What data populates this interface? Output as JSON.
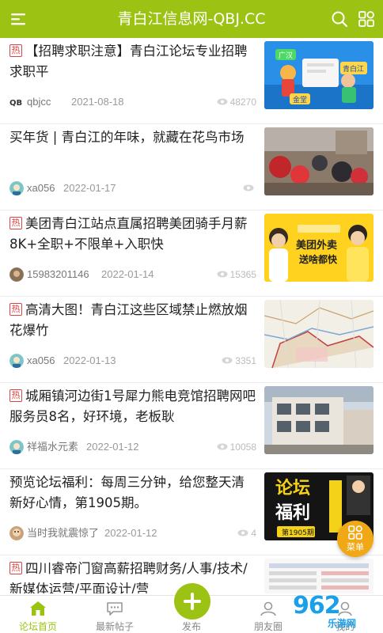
{
  "header": {
    "title": "青白江信息网-QBJ.CC",
    "menu_icon": "hamburger-icon",
    "search_icon": "search-icon",
    "grid_icon": "grid-icon",
    "bg_color": "#9cc313"
  },
  "posts": [
    {
      "hot": true,
      "tag": "热",
      "title": "【招聘求职注意】青白江论坛专业招聘求职平",
      "author": "qbjcc",
      "date": "2021-08-18",
      "views": "48270",
      "thumb_labels": [
        "广汉",
        "青白江",
        "金堂"
      ]
    },
    {
      "hot": false,
      "tag": "",
      "title": "买年货 | 青白江的年味，就藏在花鸟市场",
      "author": "xa056",
      "date": "2022-01-17",
      "views": "",
      "thumb_labels": []
    },
    {
      "hot": true,
      "tag": "热",
      "title": "美团青白江站点直属招聘美团骑手月薪8K+全职+不限单+入职快",
      "author": "15983201146",
      "date": "2022-01-14",
      "views": "15365",
      "thumb_labels": [
        "美团外卖",
        "送啥都快"
      ]
    },
    {
      "hot": true,
      "tag": "热",
      "title": "高清大图！青白江这些区域禁止燃放烟花爆竹",
      "author": "xa056",
      "date": "2022-01-13",
      "views": "3351",
      "thumb_labels": []
    },
    {
      "hot": true,
      "tag": "热",
      "title": "城厢镇河边街1号犀力熊电竞馆招聘网吧服务员8名，好环境，老板耿",
      "author": "祥福水元素",
      "date": "2022-01-12",
      "views": "10058",
      "thumb_labels": []
    },
    {
      "hot": false,
      "tag": "",
      "title": "预览论坛福利：每周三分钟，给您整天清新好心情，第1905期。",
      "author": "当时我就震惊了",
      "date": "2022-01-12",
      "views": "4",
      "thumb_labels": [
        "论坛",
        "福利",
        "第1905期"
      ]
    },
    {
      "hot": true,
      "tag": "热",
      "title": "四川睿帝门窗高薪招聘财务/人事/技术/新媒体运营/平面设计/营",
      "author": "",
      "date": "",
      "views": "",
      "thumb_labels": []
    }
  ],
  "fab": {
    "label": "菜单",
    "icon": "apps-icon"
  },
  "tabs": [
    {
      "label": "论坛首页",
      "icon": "home-icon",
      "active": true
    },
    {
      "label": "最新帖子",
      "icon": "chat-icon",
      "active": false
    },
    {
      "label": "发布",
      "icon": "plus-icon",
      "active": false
    },
    {
      "label": "朋友圈",
      "icon": "friends-icon",
      "active": false
    },
    {
      "label": "我的",
      "icon": "user-icon",
      "active": false
    }
  ],
  "watermark": {
    "big": "962",
    "small": "乐游网"
  }
}
